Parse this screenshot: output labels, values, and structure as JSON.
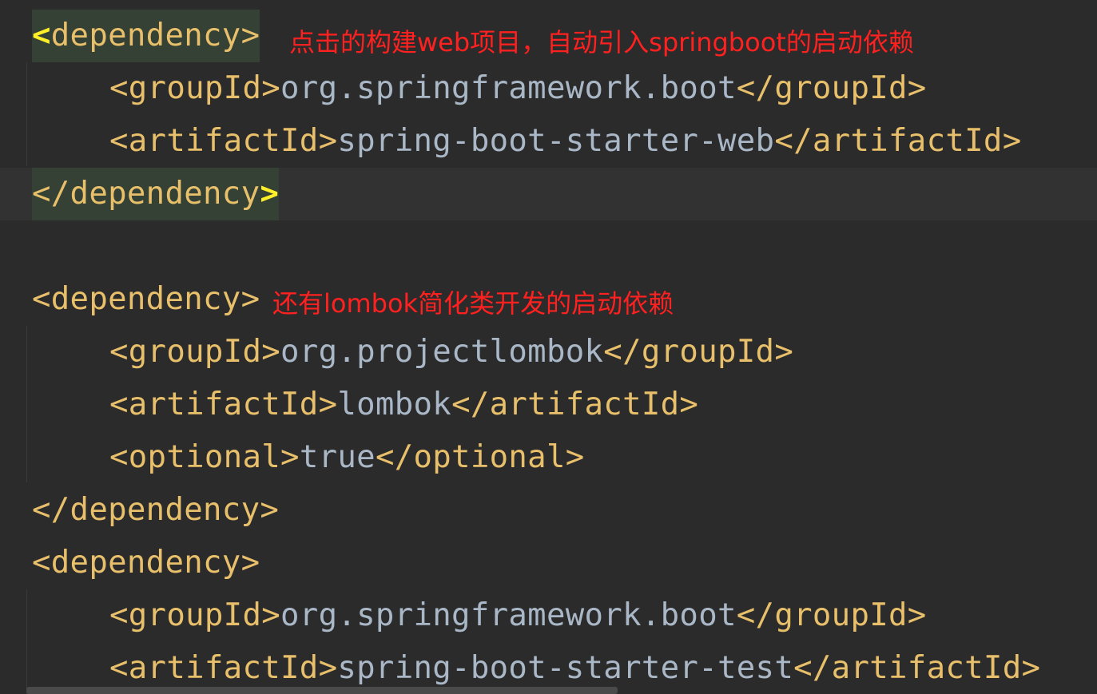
{
  "lines": [
    {
      "open": "<",
      "tag": "dependency",
      "close": ">"
    },
    {
      "open": "<groupId>",
      "value": "org.springframework.boot",
      "close": "</groupId>"
    },
    {
      "open": "<artifactId>",
      "value": "spring-boot-starter-web",
      "close": "</artifactId>"
    },
    {
      "open": "</dependency",
      "close": ">"
    },
    {
      "text": ""
    },
    {
      "text": "<dependency>"
    },
    {
      "open": "<groupId>",
      "value": "org.projectlombok",
      "close": "</groupId>"
    },
    {
      "open": "<artifactId>",
      "value": "lombok",
      "close": "</artifactId>"
    },
    {
      "open": "<optional>",
      "value": "true",
      "close": "</optional>"
    },
    {
      "text": "</dependency>"
    },
    {
      "text": "<dependency>"
    },
    {
      "open": "<groupId>",
      "value": "org.springframework.boot",
      "close": "</groupId>"
    },
    {
      "open": "<artifactId>",
      "value": "spring-boot-starter-test",
      "close": "</artifactId>"
    }
  ],
  "annotations": {
    "web": "点击的构建web项目，自动引入springboot的启动依赖",
    "lombok": "还有lombok简化类开发的启动依赖"
  },
  "colors": {
    "background": "#2b2b2b",
    "current_line": "#323232",
    "tag": "#e8bf6a",
    "text_value": "#a9b7c6",
    "brace_match_bg": "#344134",
    "brace_match_fg": "#ffef28",
    "annotation": "#ff2020"
  }
}
